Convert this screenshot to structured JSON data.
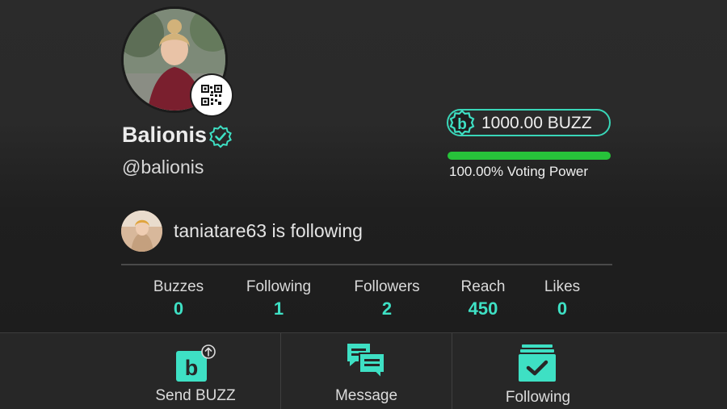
{
  "profile": {
    "display_name": "Balionis",
    "handle": "@balionis",
    "verified": true
  },
  "wallet": {
    "buzz_amount": "1000.00 BUZZ",
    "voting_power_text": "100.00% Voting Power",
    "voting_power_fraction": 1.0
  },
  "social_proof": {
    "text": "taniatare63 is following"
  },
  "stats": [
    {
      "label": "Buzzes",
      "value": "0"
    },
    {
      "label": "Following",
      "value": "1"
    },
    {
      "label": "Followers",
      "value": "2"
    },
    {
      "label": "Reach",
      "value": "450"
    },
    {
      "label": "Likes",
      "value": "0"
    }
  ],
  "actions": [
    {
      "label": "Send BUZZ",
      "icon": "send-buzz-icon"
    },
    {
      "label": "Message",
      "icon": "message-icon"
    },
    {
      "label": "Following",
      "icon": "following-check-icon"
    }
  ],
  "colors": {
    "accent": "#3ee0c4",
    "voting_bar": "#27c23a",
    "background": "#1f1f1f"
  }
}
